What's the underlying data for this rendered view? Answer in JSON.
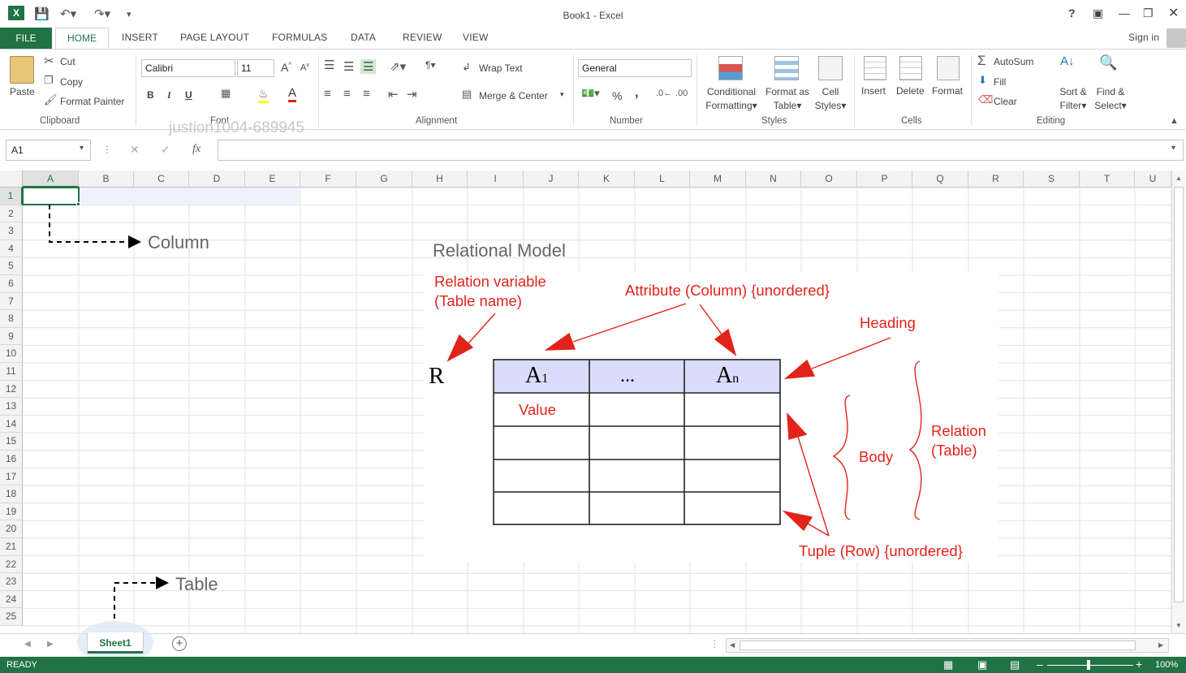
{
  "window": {
    "title": "Book1 - Excel",
    "help": "?",
    "sign_in": "Sign in"
  },
  "tabs": [
    "FILE",
    "HOME",
    "INSERT",
    "PAGE LAYOUT",
    "FORMULAS",
    "DATA",
    "REVIEW",
    "VIEW"
  ],
  "ribbon": {
    "clipboard": {
      "paste": "Paste",
      "cut": "Cut",
      "copy": "Copy",
      "format_painter": "Format Painter",
      "label": "Clipboard"
    },
    "font": {
      "name": "Calibri",
      "size": "11",
      "bold": "B",
      "italic": "I",
      "underline": "U",
      "label": "Font"
    },
    "alignment": {
      "wrap": "Wrap Text",
      "merge": "Merge & Center",
      "label": "Alignment"
    },
    "number": {
      "format": "General",
      "percent": "%",
      "comma": ",",
      "label": "Number"
    },
    "styles": {
      "conditional": "Conditional",
      "conditional2": "Formatting",
      "format_as": "Format as",
      "format_as2": "Table",
      "cell": "Cell",
      "cell2": "Styles",
      "label": "Styles"
    },
    "cells": {
      "insert": "Insert",
      "delete": "Delete",
      "format": "Format",
      "label": "Cells"
    },
    "editing": {
      "autosum": "AutoSum",
      "fill": "Fill",
      "clear": "Clear",
      "sort": "Sort &",
      "sort2": "Filter",
      "find": "Find &",
      "find2": "Select",
      "label": "Editing"
    }
  },
  "watermark": "justion1004-689945",
  "formula_bar": {
    "name_box": "A1",
    "fx": "fx",
    "value": ""
  },
  "columns": [
    "A",
    "B",
    "C",
    "D",
    "E",
    "F",
    "G",
    "H",
    "I",
    "J",
    "K",
    "L",
    "M",
    "N",
    "O",
    "P",
    "Q",
    "R",
    "S",
    "T",
    "U"
  ],
  "rows": [
    "1",
    "2",
    "3",
    "4",
    "5",
    "6",
    "7",
    "8",
    "9",
    "10",
    "11",
    "12",
    "13",
    "14",
    "15",
    "16",
    "17",
    "18",
    "19",
    "20",
    "21",
    "22",
    "23",
    "24",
    "25"
  ],
  "diagram": {
    "column_label": "Column",
    "table_label": "Table",
    "title": "Relational Model",
    "relation_variable": "Relation variable",
    "table_name": "(Table name)",
    "attribute": "Attribute (Column) {unordered}",
    "heading": "Heading",
    "r": "R",
    "a1": "A",
    "a1_sub": "1",
    "dots": "...",
    "an": "A",
    "an_sub": "n",
    "value": "Value",
    "body": "Body",
    "relation": "Relation",
    "relation_table": "(Table)",
    "tuple": "Tuple (Row) {unordered}"
  },
  "sheets": [
    "Sheet1"
  ],
  "status": {
    "text": "READY",
    "zoom": "100%"
  },
  "colors": {
    "excel_green": "#217346",
    "annotation_red": "#e2231a"
  }
}
